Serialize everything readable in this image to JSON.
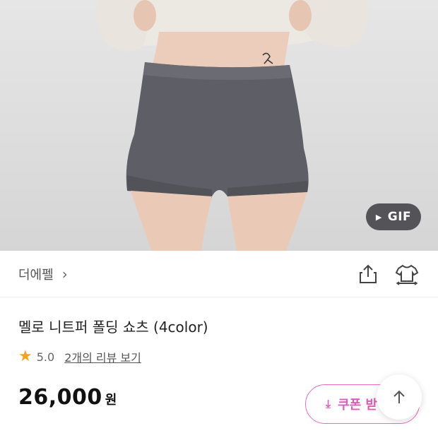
{
  "hero": {
    "gif_label": "GIF",
    "play_icon": "play-icon"
  },
  "brand": {
    "name": "더에펠",
    "chevron_icon": "chevron-right-icon",
    "share_icon": "share-icon",
    "outfit_icon": "clothes-icon"
  },
  "product": {
    "title": "멜로 니트퍼 폴딩 쇼츠 (4color)",
    "rating": "5.0",
    "review_link": "2개의 리뷰 보기",
    "price": "26,000",
    "currency": "원"
  },
  "coupon": {
    "label": "쿠폰 받",
    "icon": "download-icon",
    "border_color": "#e86fc2"
  },
  "scroll_top": {
    "icon": "arrow-up-icon"
  },
  "colors": {
    "accent": "#e05bb8",
    "star": "#f4a31c"
  }
}
